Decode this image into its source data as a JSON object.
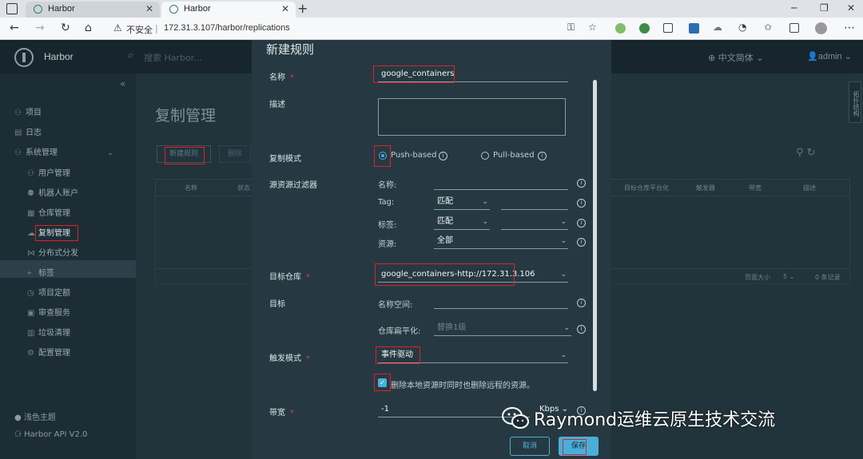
{
  "browser": {
    "tabs": [
      {
        "title": "Harbor"
      },
      {
        "title": "Harbor"
      }
    ],
    "address": {
      "security_label": "不安全",
      "url": "172.31.3.107/harbor/replications"
    }
  },
  "harbor": {
    "brand": "Harbor",
    "search_placeholder": "搜索 Harbor...",
    "language": "中文简体",
    "user": "admin",
    "right_tab": "拓扑结构",
    "sidebar": {
      "items": [
        {
          "label": "项目",
          "icon": "project-icon"
        },
        {
          "label": "日志",
          "icon": "log-icon"
        },
        {
          "label": "系统管理",
          "icon": "admin-icon"
        },
        {
          "label": "用户管理",
          "icon": "user-icon"
        },
        {
          "label": "机器人账户",
          "icon": "robot-icon"
        },
        {
          "label": "仓库管理",
          "icon": "registry-icon"
        },
        {
          "label": "复制管理",
          "icon": "replication-icon"
        },
        {
          "label": "分布式分发",
          "icon": "distribution-icon"
        },
        {
          "label": "标签",
          "icon": "tag-icon"
        },
        {
          "label": "项目定额",
          "icon": "quota-icon"
        },
        {
          "label": "审查服务",
          "icon": "scanner-icon"
        },
        {
          "label": "垃圾清理",
          "icon": "gc-icon"
        },
        {
          "label": "配置管理",
          "icon": "config-icon"
        }
      ],
      "theme": "浅色主题",
      "api": "Harbor API V2.0"
    },
    "page_title": "复制管理",
    "new_rule_button": "新建规则",
    "delete_button": "删除",
    "columns": [
      "名称",
      "状态",
      "目标仓库平台化",
      "触发器",
      "带宽",
      "描述"
    ],
    "pager": {
      "page_size_label": "页面大小",
      "page_size": "5",
      "count": "0 条记录"
    }
  },
  "modal": {
    "title": "新建规则",
    "name_label": "名称",
    "name_value": "google_containers",
    "desc_label": "描述",
    "mode_label": "复制模式",
    "push_label": "Push-based",
    "pull_label": "Pull-based",
    "source_filter_label": "源资源过滤器",
    "filter_name_label": "名称:",
    "filter_tag_label": "Tag:",
    "filter_tag_value": "匹配",
    "filter_label_label": "标签:",
    "filter_label_value": "匹配",
    "filter_resource_label": "资源:",
    "filter_resource_value": "全部",
    "dest_registry_label": "目标仓库",
    "dest_registry_value": "google_containers-http://172.31.3.106",
    "dest_label": "目标",
    "namespace_label": "名称空间:",
    "flatten_label": "仓库扁平化:",
    "flatten_value": "替换1级",
    "trigger_label": "触发模式",
    "trigger_value": "事件驱动",
    "delete_remote_label": "删除本地资源时同时也删除远程的资源。",
    "bandwidth_label": "带宽",
    "bandwidth_value": "-1",
    "bandwidth_unit": "Kbps",
    "cancel_button": "取消",
    "save_button": "保存"
  },
  "watermark": "Raymond运维云原生技术交流",
  "colors": {
    "accent": "#49afd9",
    "highlight": "#e0202a",
    "app_bg": "#21333b",
    "modal_bg": "#263942"
  }
}
